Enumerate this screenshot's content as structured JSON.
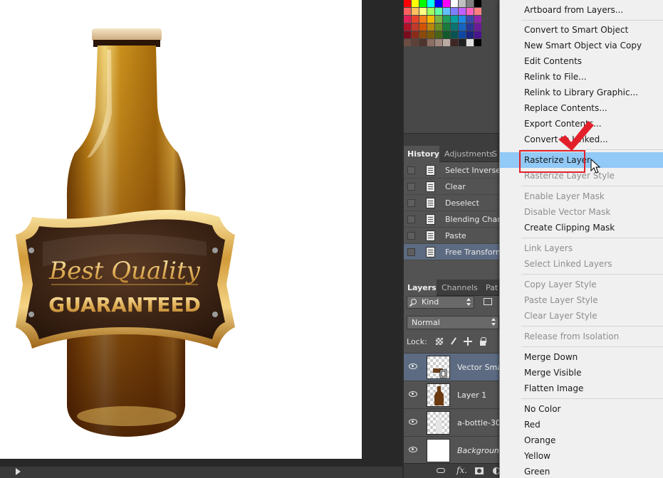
{
  "history": {
    "tabs": [
      "History",
      "Adjustments",
      "S"
    ],
    "items": [
      {
        "label": "Select Inverse"
      },
      {
        "label": "Clear"
      },
      {
        "label": "Deselect"
      },
      {
        "label": "Blending Change"
      },
      {
        "label": "Paste"
      },
      {
        "label": "Free Transform",
        "selected": true
      }
    ]
  },
  "layers": {
    "tabs": [
      "Layers",
      "Channels",
      "Pat"
    ],
    "kind_filter": "Kind",
    "blend_mode": "Normal",
    "lock_label": "Lock:",
    "items": [
      {
        "name": "Vector Sma",
        "selected": true
      },
      {
        "name": "Layer 1"
      },
      {
        "name": "a-bottle-30"
      },
      {
        "name": "Background"
      }
    ],
    "footer": {
      "fx_label": "fx."
    }
  },
  "artwork": {
    "script_text": "Best Quality",
    "banner_text": "GUARANTEED",
    "colors": {
      "gold": "#d9a441",
      "dark_label": "#3a2415",
      "bottle": "#b07a12"
    }
  },
  "context_menu": {
    "items": [
      {
        "label": "Artboard from Layers..."
      },
      {
        "label": "Convert to Smart Object"
      },
      {
        "label": "New Smart Object via Copy"
      },
      {
        "label": "Edit Contents"
      },
      {
        "label": "Relink to File..."
      },
      {
        "label": "Relink to Library Graphic..."
      },
      {
        "label": "Replace Contents..."
      },
      {
        "label": "Export Contents..."
      },
      {
        "label": "Convert to Linked..."
      },
      {
        "label": "Rasterize Layer",
        "highlighted": true
      },
      {
        "label": "Rasterize Layer Style",
        "disabled": true
      },
      {
        "label": "Enable Layer Mask",
        "disabled": true
      },
      {
        "label": "Disable Vector Mask",
        "disabled": true
      },
      {
        "label": "Create Clipping Mask"
      },
      {
        "label": "Link Layers",
        "disabled": true
      },
      {
        "label": "Select Linked Layers",
        "disabled": true
      },
      {
        "label": "Copy Layer Style",
        "disabled": true
      },
      {
        "label": "Paste Layer Style",
        "disabled": true
      },
      {
        "label": "Clear Layer Style",
        "disabled": true
      },
      {
        "label": "Release from Isolation",
        "disabled": true
      },
      {
        "label": "Merge Down"
      },
      {
        "label": "Merge Visible"
      },
      {
        "label": "Flatten Image"
      },
      {
        "label": "No Color"
      },
      {
        "label": "Red"
      },
      {
        "label": "Orange"
      },
      {
        "label": "Yellow"
      },
      {
        "label": "Green"
      }
    ],
    "highlight_color": "#91c9f7",
    "annotation_color": "#e3202a"
  }
}
